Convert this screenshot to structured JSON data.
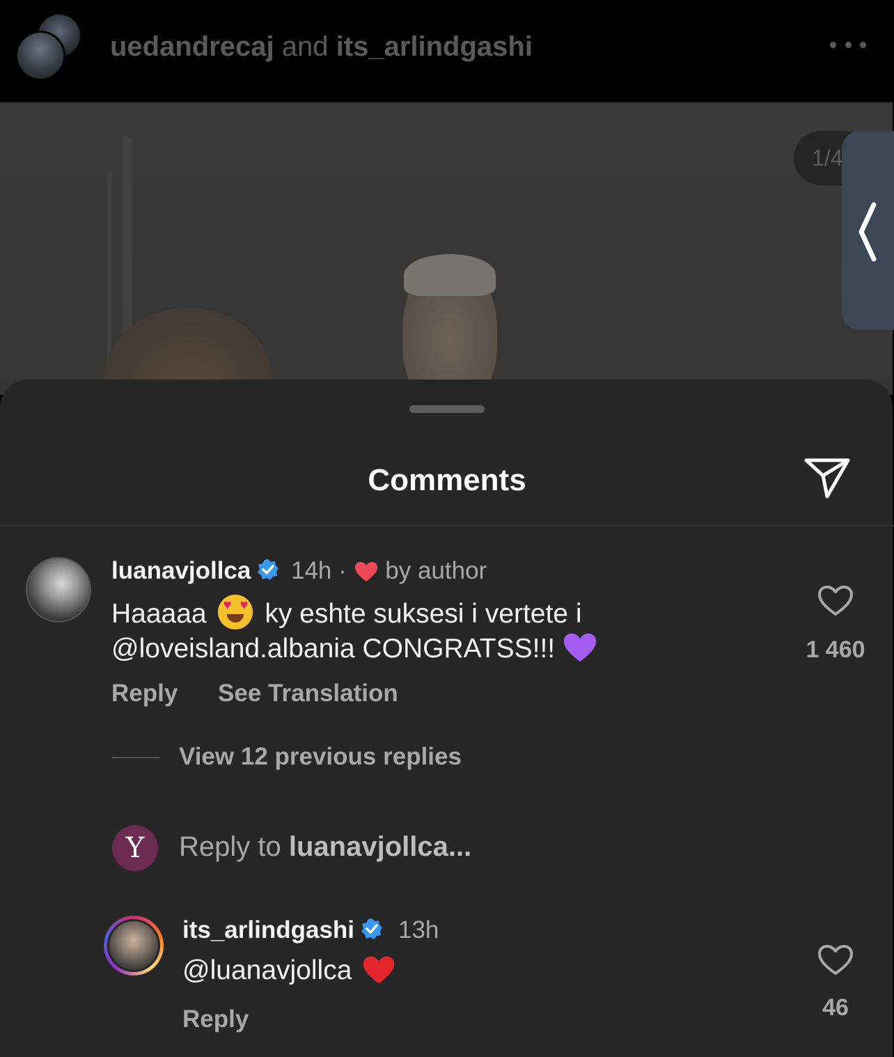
{
  "header": {
    "user1": "uedandrecaj",
    "conjunction": "and",
    "user2": "its_arlindgashi",
    "more_icon": "more-horizontal-icon"
  },
  "media": {
    "counter": "1/4",
    "side_icon": "chevron-left-icon"
  },
  "sheet": {
    "title": "Comments",
    "share_icon": "paper-plane-icon"
  },
  "comments": [
    {
      "username": "luanavjollca",
      "time": "14h",
      "liked_by_author": "by author",
      "text_line1_a": "Haaaaa",
      "text_line1_b": "ky eshte suksesi i vertete i",
      "text_line2": "@loveisland.albania CONGRATSS!!!",
      "reply": "Reply",
      "translate": "See Translation",
      "likes": "1 460",
      "view_replies": "View 12 previous replies"
    },
    {
      "username": "its_arlindgashi",
      "time": "13h",
      "text": "@luanavjollca",
      "reply": "Reply",
      "likes": "46"
    }
  ],
  "reply_bar": {
    "prefix": "Reply to",
    "target": "luanavjollca...",
    "avatar_letter": "Y"
  },
  "colors": {
    "sheet_bg": "#262626",
    "verified": "#3897f0",
    "heart_red": "#ed4956",
    "secondary_text": "#a8a8a8"
  }
}
